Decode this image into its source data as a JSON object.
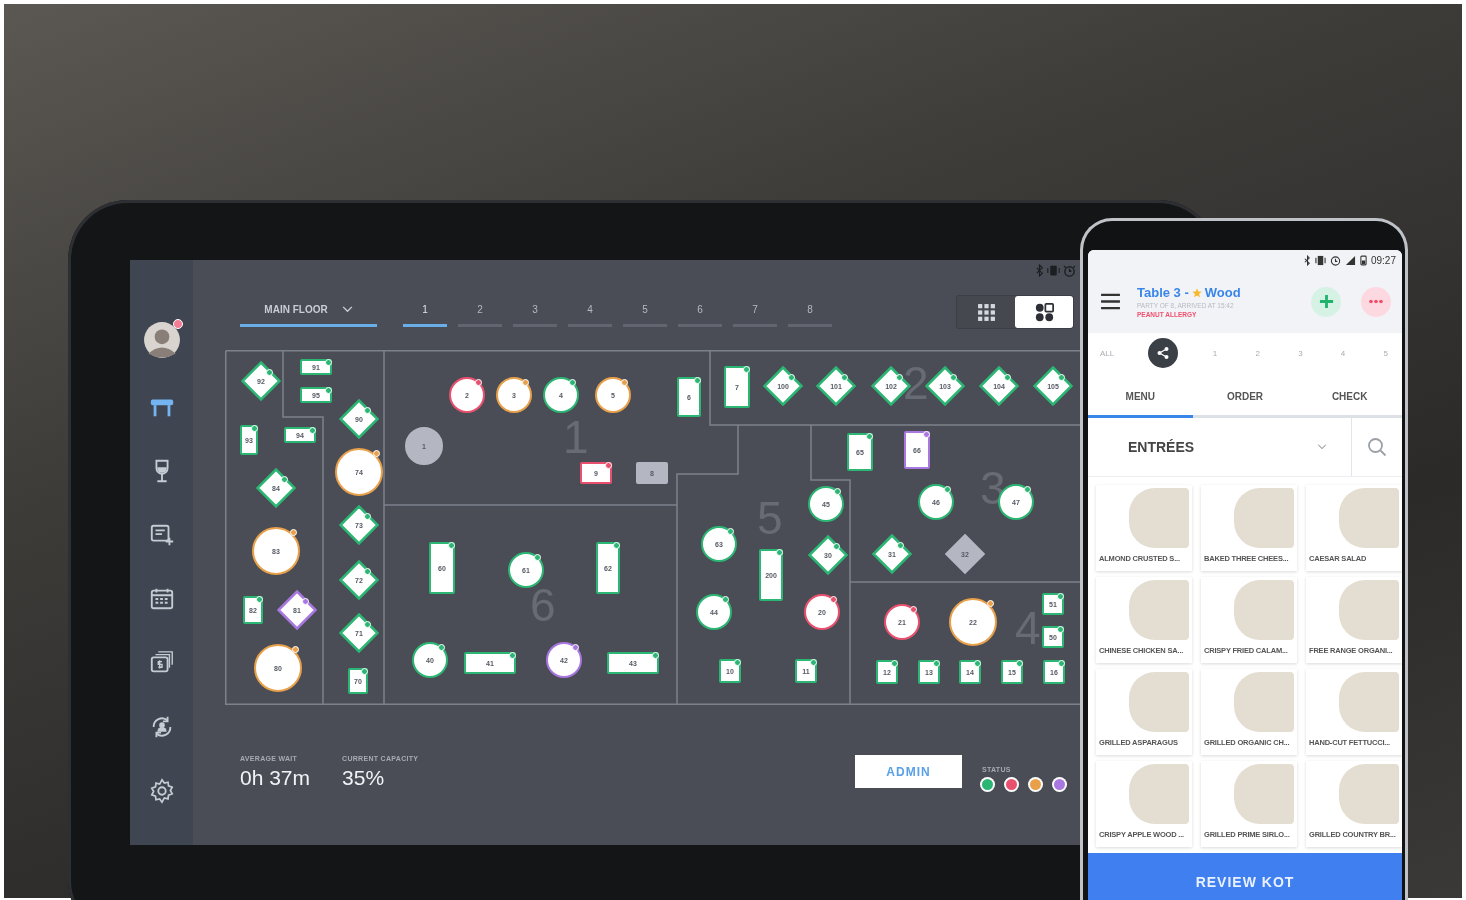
{
  "tablet": {
    "sidebar": [
      {
        "kind": "tables",
        "selected": true
      },
      {
        "kind": "drinks",
        "selected": false
      },
      {
        "kind": "new-order",
        "selected": false
      },
      {
        "kind": "calendar",
        "selected": false
      },
      {
        "kind": "payments",
        "selected": false
      },
      {
        "kind": "staff",
        "selected": false
      },
      {
        "kind": "settings",
        "selected": false
      }
    ],
    "avatar": {
      "notification": true
    },
    "floor_selector": {
      "label": "MAIN FLOOR",
      "selected": true
    },
    "floor_tabs": [
      {
        "label": "1",
        "selected": true
      },
      {
        "label": "2",
        "selected": false
      },
      {
        "label": "3",
        "selected": false
      },
      {
        "label": "4",
        "selected": false
      },
      {
        "label": "5",
        "selected": false
      },
      {
        "label": "6",
        "selected": false
      },
      {
        "label": "7",
        "selected": false
      },
      {
        "label": "8",
        "selected": false
      }
    ],
    "view_toggle": [
      {
        "kind": "grid",
        "selected": false
      },
      {
        "kind": "layout",
        "selected": true
      }
    ],
    "zones": [
      "1",
      "2",
      "3",
      "4",
      "5",
      "6"
    ],
    "tables": [
      {
        "label": "92",
        "kind": "diamond",
        "color": "#2bb673",
        "filled": false
      },
      {
        "label": "91",
        "kind": "rect",
        "color": "#2bb673",
        "filled": false
      },
      {
        "label": "95",
        "kind": "rect",
        "color": "#2bb673",
        "filled": false
      },
      {
        "label": "93",
        "kind": "rect",
        "color": "#2bb673",
        "filled": false
      },
      {
        "label": "94",
        "kind": "rect",
        "color": "#2bb673",
        "filled": false
      },
      {
        "label": "90",
        "kind": "diamond",
        "color": "#2bb673",
        "filled": false
      },
      {
        "label": "74",
        "kind": "round",
        "color": "#e8a04a",
        "filled": false
      },
      {
        "label": "84",
        "kind": "diamond",
        "color": "#2bb673",
        "filled": false
      },
      {
        "label": "83",
        "kind": "round",
        "color": "#e8a04a",
        "filled": false
      },
      {
        "label": "73",
        "kind": "diamond",
        "color": "#2bb673",
        "filled": false
      },
      {
        "label": "72",
        "kind": "diamond",
        "color": "#2bb673",
        "filled": false
      },
      {
        "label": "82",
        "kind": "rect",
        "color": "#2bb673",
        "filled": false
      },
      {
        "label": "81",
        "kind": "diamond",
        "color": "#a877e0",
        "filled": false
      },
      {
        "label": "71",
        "kind": "diamond",
        "color": "#2bb673",
        "filled": false
      },
      {
        "label": "80",
        "kind": "round",
        "color": "#e8a04a",
        "filled": false
      },
      {
        "label": "70",
        "kind": "rect",
        "color": "#2bb673",
        "filled": false
      },
      {
        "label": "1",
        "kind": "round",
        "color": "#b4b7c2",
        "filled": true
      },
      {
        "label": "2",
        "kind": "round",
        "color": "#e8506e",
        "filled": false
      },
      {
        "label": "3",
        "kind": "round",
        "color": "#e8a04a",
        "filled": false
      },
      {
        "label": "4",
        "kind": "round",
        "color": "#2bb673",
        "filled": false
      },
      {
        "label": "5",
        "kind": "round",
        "color": "#e8a04a",
        "filled": false
      },
      {
        "label": "6",
        "kind": "rect",
        "color": "#2bb673",
        "filled": false
      },
      {
        "label": "9",
        "kind": "rect",
        "color": "#e8506e",
        "filled": false
      },
      {
        "label": "8",
        "kind": "rect",
        "color": "#b4b7c2",
        "filled": true
      },
      {
        "label": "7",
        "kind": "rect",
        "color": "#2bb673",
        "filled": false
      },
      {
        "label": "100",
        "kind": "diamond",
        "color": "#2bb673",
        "filled": false
      },
      {
        "label": "101",
        "kind": "diamond",
        "color": "#2bb673",
        "filled": false
      },
      {
        "label": "102",
        "kind": "diamond",
        "color": "#2bb673",
        "filled": false
      },
      {
        "label": "103",
        "kind": "diamond",
        "color": "#2bb673",
        "filled": false
      },
      {
        "label": "104",
        "kind": "diamond",
        "color": "#2bb673",
        "filled": false
      },
      {
        "label": "105",
        "kind": "diamond",
        "color": "#2bb673",
        "filled": false
      },
      {
        "label": "65",
        "kind": "rect",
        "color": "#2bb673",
        "filled": false
      },
      {
        "label": "66",
        "kind": "rect",
        "color": "#a877e0",
        "filled": false
      },
      {
        "label": "45",
        "kind": "round",
        "color": "#2bb673",
        "filled": false
      },
      {
        "label": "46",
        "kind": "round",
        "color": "#2bb673",
        "filled": false
      },
      {
        "label": "47",
        "kind": "round",
        "color": "#2bb673",
        "filled": false
      },
      {
        "label": "63",
        "kind": "round",
        "color": "#2bb673",
        "filled": false
      },
      {
        "label": "30",
        "kind": "diamond",
        "color": "#2bb673",
        "filled": false
      },
      {
        "label": "31",
        "kind": "diamond",
        "color": "#2bb673",
        "filled": false
      },
      {
        "label": "32",
        "kind": "diamond",
        "color": "#b4b7c2",
        "filled": true
      },
      {
        "label": "200",
        "kind": "rect",
        "color": "#2bb673",
        "filled": false
      },
      {
        "label": "60",
        "kind": "rect",
        "color": "#2bb673",
        "filled": false
      },
      {
        "label": "61",
        "kind": "round",
        "color": "#2bb673",
        "filled": false
      },
      {
        "label": "62",
        "kind": "rect",
        "color": "#2bb673",
        "filled": false
      },
      {
        "label": "44",
        "kind": "round",
        "color": "#2bb673",
        "filled": false
      },
      {
        "label": "20",
        "kind": "round",
        "color": "#e8506e",
        "filled": false
      },
      {
        "label": "21",
        "kind": "round",
        "color": "#e8506e",
        "filled": false
      },
      {
        "label": "22",
        "kind": "round",
        "color": "#e8a04a",
        "filled": false
      },
      {
        "label": "51",
        "kind": "rect",
        "color": "#2bb673",
        "filled": false
      },
      {
        "label": "50",
        "kind": "rect",
        "color": "#2bb673",
        "filled": false
      },
      {
        "label": "40",
        "kind": "round",
        "color": "#2bb673",
        "filled": false
      },
      {
        "label": "41",
        "kind": "rect",
        "color": "#2bb673",
        "filled": false
      },
      {
        "label": "42",
        "kind": "round",
        "color": "#a877e0",
        "filled": false
      },
      {
        "label": "43",
        "kind": "rect",
        "color": "#2bb673",
        "filled": false
      },
      {
        "label": "10",
        "kind": "rect",
        "color": "#2bb673",
        "filled": false
      },
      {
        "label": "11",
        "kind": "rect",
        "color": "#2bb673",
        "filled": false
      },
      {
        "label": "12",
        "kind": "rect",
        "color": "#2bb673",
        "filled": false
      },
      {
        "label": "13",
        "kind": "rect",
        "color": "#2bb673",
        "filled": false
      },
      {
        "label": "14",
        "kind": "rect",
        "color": "#2bb673",
        "filled": false
      },
      {
        "label": "15",
        "kind": "rect",
        "color": "#2bb673",
        "filled": false
      },
      {
        "label": "16",
        "kind": "rect",
        "color": "#2bb673",
        "filled": false
      }
    ],
    "stats": [
      {
        "label": "AVERAGE WAIT",
        "value": "0h 37m"
      },
      {
        "label": "CURRENT CAPACITY",
        "value": "35%"
      }
    ],
    "admin_button": "ADMIN",
    "status": {
      "label": "STATUS",
      "legend": [
        {
          "color": "#2bb673"
        },
        {
          "color": "#e8506e"
        },
        {
          "color": "#e8a04a"
        },
        {
          "color": "#a877e0"
        }
      ]
    }
  },
  "phone": {
    "status_bar": {
      "time": "09:27"
    },
    "header": {
      "title": "Table 3 -",
      "starred": true,
      "guest": "Wood",
      "subtitle": "PARTY OF 8, ARRIVED AT 15:42",
      "alert": "PEANUT ALLERGY"
    },
    "seats": [
      "ALL",
      "1",
      "2",
      "3",
      "4",
      "5"
    ],
    "tabs": [
      {
        "label": "MENU",
        "selected": true
      },
      {
        "label": "ORDER",
        "selected": false
      },
      {
        "label": "CHECK",
        "selected": false
      }
    ],
    "category": "ENTRÉES",
    "items": [
      "ALMOND CRUSTED S...",
      "BAKED THREE CHEES...",
      "CAESAR SALAD",
      "CHINESE CHICKEN SA...",
      "CRISPY FRIED CALAM...",
      "FREE RANGE ORGANI...",
      "GRILLED ASPARAGUS",
      "GRILLED ORGANIC CH...",
      "HAND-CUT FETTUCCI...",
      "CRISPY APPLE WOOD ...",
      "GRILLED PRIME SIRLO...",
      "GRILLED COUNTRY BR..."
    ],
    "primary_button": "REVIEW KOT"
  }
}
